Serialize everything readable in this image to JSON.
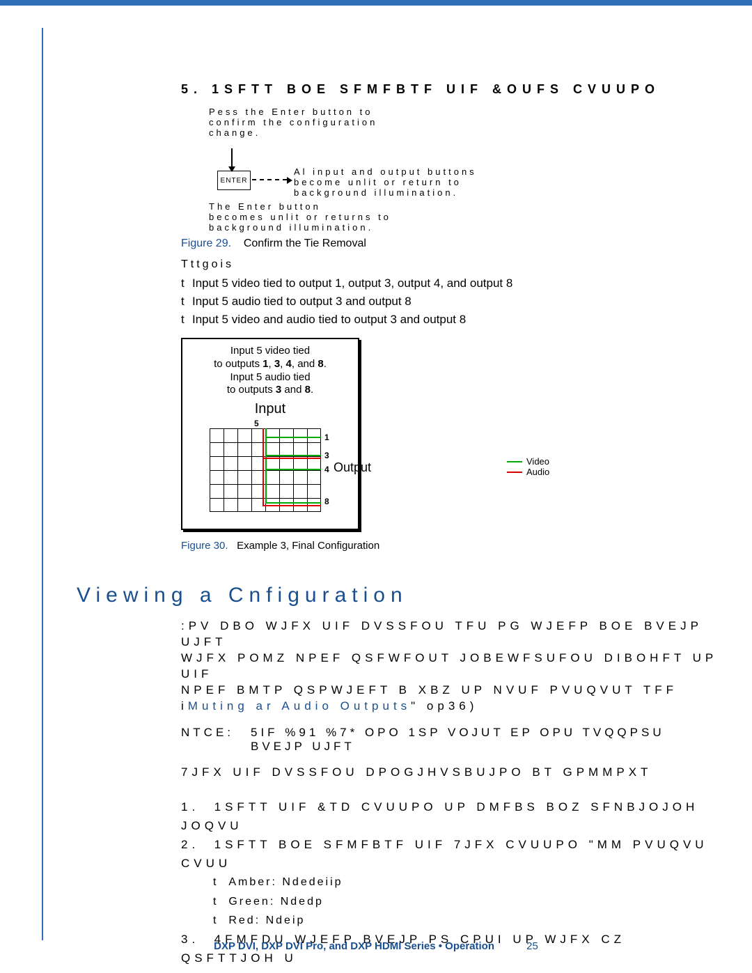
{
  "step5": {
    "number": "5.",
    "title": "1SFTT BOE SFMFBTF UIF &OUFS CVUUPO"
  },
  "diagram1": {
    "press_text": "Pess the Enter button to\nconfirm the configuration\nchange.",
    "enter_label": "ENTER",
    "all_text": "Al input and output buttons\nbecome unlit or return to\nbackground illumination.",
    "enter_unlit": "The Enter button\nbecomes unlit or returns to\nbackground illumination."
  },
  "figure29": {
    "label": "Figure 29.",
    "caption": "Confirm the Tie Removal"
  },
  "ties_label": "Tttgois",
  "ties": [
    "Input 5 video tied to output 1, output 3, output 4, and output 8",
    "Input 5 audio tied to output 3 and output 8",
    "Input 5 video and audio tied to output 3 and output 8"
  ],
  "matrix_box": {
    "line1": "Input 5 video tied",
    "line2": "to outputs 1, 3, 4, and 8.",
    "line3": "Input 5 audio tied",
    "line4": "to outputs 3 and 8.",
    "input_label": "Input",
    "input_num": "5",
    "output_label": "Output",
    "out_nums": {
      "n1": "1",
      "n3": "3",
      "n4": "4",
      "n8": "8"
    }
  },
  "legend": {
    "video": "Video",
    "audio": "Audio"
  },
  "figure30": {
    "label": "Figure 30.",
    "caption": "Example 3, Final Configuration"
  },
  "heading": "Viewing a Cnfiguration",
  "para1": {
    "l1": ":PV DBO WJFX UIF DVSSFOU TFU PG WJEFP BOE BVEJP UJFT",
    "l2": "WJFX POMZ NPEF QSFWFOUT JOBEWFSUFOU DIBOHFT UP UIF",
    "l3_a": "NPEF BMTP QSPWJEFT B XBZ UP NVUF PVUQVUT  TFF i",
    "link": "Muting ar Audio Outputs",
    "l3_b": "\"  op36)"
  },
  "note": {
    "label": "NTCE:",
    "text": "5IF %91 %7* OPO 1SP VOJUT EP OPU TVQQPSU BVEJP UJFT"
  },
  "view_line": "7JFX UIF DVSSFOU DPOGJHVSBUJPO BT GPMMPXT",
  "steps2": {
    "s1": {
      "n": "1.",
      "t": "1SFTT UIF &TD CVUUPO UP DMFBS BOZ SFNBJOJOH JOQVU"
    },
    "s2": {
      "n": "2.",
      "t": "1SFTT BOE SFMFBTF UIF 7JFX CVUUPO  \"MM PVUQVU CVUU"
    },
    "s3": {
      "n": "3.",
      "t": "4FMFDU WJEFP  BVEJP  PS CPUI UP WJFX CZ QSFTTJOH U"
    }
  },
  "sub_bullets": [
    {
      "b": "t",
      "label": "Amber:",
      "t": " Ndedeiip"
    },
    {
      "b": "t",
      "label": "Green:",
      "t": " Ndedp"
    },
    {
      "b": "t",
      "label": "Red:",
      "t": " Ndeip"
    }
  ],
  "footer": {
    "text": "DXP DVI, DXP DVI Pro, and DXP HDMI Series • Operation",
    "page": "25"
  }
}
